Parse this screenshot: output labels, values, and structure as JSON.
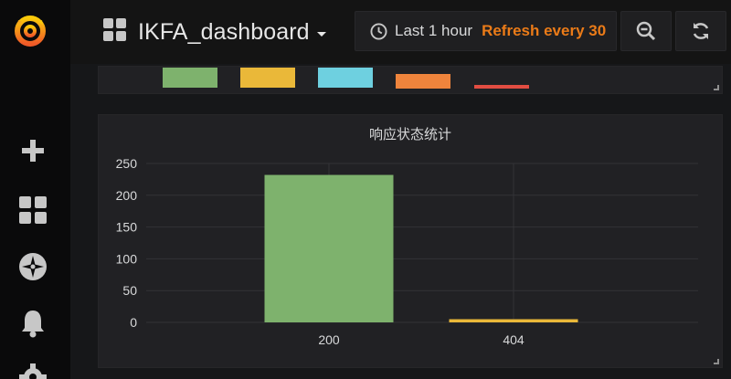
{
  "icons": {
    "logo": "grafana-logo",
    "dashboard_picker": "grid-icon",
    "time": "clock-icon",
    "zoom": "zoom-out-icon",
    "refresh": "refresh-icon",
    "sidemenu": [
      "plus-icon",
      "dashboards-icon",
      "explore-compass-icon",
      "alerting-bell-icon",
      "gear-icon"
    ]
  },
  "navbar": {
    "dashboard_title": "IKFA_dashboard",
    "time_range": "Last 1 hour",
    "refresh_label": "Refresh every 30"
  },
  "colors": {
    "green": "#7eb26d",
    "yellow": "#eab839",
    "cyan": "#6ed0e0",
    "orange": "#ef843c",
    "red": "#e24d42",
    "accent_orange": "#eb7b18"
  },
  "top_panel": {
    "bars": [
      {
        "color": "#7eb26d"
      },
      {
        "color": "#eab839"
      },
      {
        "color": "#6ed0e0"
      },
      {
        "color": "#ef843c"
      },
      {
        "color": "#e24d42"
      }
    ]
  },
  "chart_data": {
    "type": "bar",
    "title": "响应状态统计",
    "categories": [
      "200",
      "404"
    ],
    "values": [
      232,
      5
    ],
    "colors": [
      "#7eb26d",
      "#eab839"
    ],
    "ylim": [
      0,
      250
    ],
    "yticks": [
      "250",
      "200",
      "150",
      "100",
      "50",
      "0"
    ],
    "grid": true
  }
}
